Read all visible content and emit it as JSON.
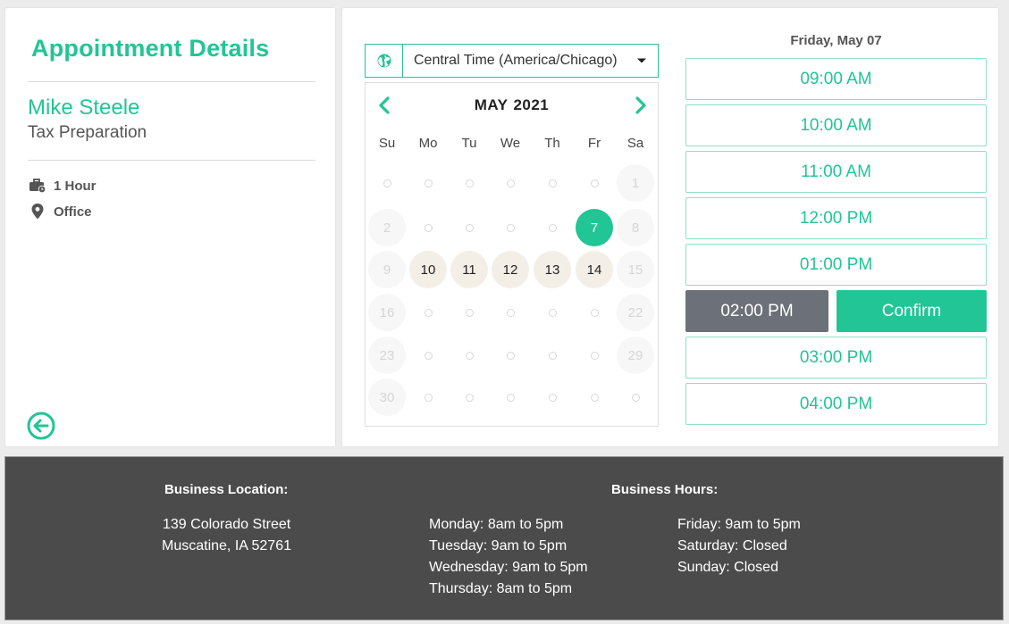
{
  "left": {
    "title": "Appointment Details",
    "name": "Mike Steele",
    "service": "Tax Preparation",
    "duration": "1 Hour",
    "location": "Office",
    "icons": {
      "duration": "briefcase-clock-icon",
      "location": "map-pin-icon",
      "back": "back-arrow-circle-icon"
    }
  },
  "timezone": {
    "label": "Central Time (America/Chicago)",
    "icon": "globe-icon"
  },
  "calendar": {
    "month": "MAY",
    "year": "2021",
    "weekdays": [
      "Su",
      "Mo",
      "Tu",
      "We",
      "Th",
      "Fr",
      "Sa"
    ],
    "selected_day": "7",
    "weeks": [
      [
        {
          "t": "",
          "s": "dot"
        },
        {
          "t": "",
          "s": "dot"
        },
        {
          "t": "",
          "s": "dot"
        },
        {
          "t": "",
          "s": "dot"
        },
        {
          "t": "",
          "s": "dot"
        },
        {
          "t": "",
          "s": "dot"
        },
        {
          "t": "1",
          "s": "off"
        }
      ],
      [
        {
          "t": "2",
          "s": "off"
        },
        {
          "t": "",
          "s": "dot"
        },
        {
          "t": "",
          "s": "dot"
        },
        {
          "t": "",
          "s": "dot"
        },
        {
          "t": "",
          "s": "dot"
        },
        {
          "t": "7",
          "s": "sel"
        },
        {
          "t": "8",
          "s": "off"
        }
      ],
      [
        {
          "t": "9",
          "s": "off"
        },
        {
          "t": "10",
          "s": "avail"
        },
        {
          "t": "11",
          "s": "avail"
        },
        {
          "t": "12",
          "s": "avail"
        },
        {
          "t": "13",
          "s": "avail"
        },
        {
          "t": "14",
          "s": "avail"
        },
        {
          "t": "15",
          "s": "off"
        }
      ],
      [
        {
          "t": "16",
          "s": "off"
        },
        {
          "t": "",
          "s": "dot"
        },
        {
          "t": "",
          "s": "dot"
        },
        {
          "t": "",
          "s": "dot"
        },
        {
          "t": "",
          "s": "dot"
        },
        {
          "t": "",
          "s": "dot"
        },
        {
          "t": "22",
          "s": "off"
        }
      ],
      [
        {
          "t": "23",
          "s": "off"
        },
        {
          "t": "",
          "s": "dot"
        },
        {
          "t": "",
          "s": "dot"
        },
        {
          "t": "",
          "s": "dot"
        },
        {
          "t": "",
          "s": "dot"
        },
        {
          "t": "",
          "s": "dot"
        },
        {
          "t": "29",
          "s": "off"
        }
      ],
      [
        {
          "t": "30",
          "s": "off"
        },
        {
          "t": "",
          "s": "dot"
        },
        {
          "t": "",
          "s": "dot"
        },
        {
          "t": "",
          "s": "dot"
        },
        {
          "t": "",
          "s": "dot"
        },
        {
          "t": "",
          "s": "dot"
        },
        {
          "t": "",
          "s": "dot"
        }
      ]
    ]
  },
  "schedule": {
    "date_heading": "Friday, May 07",
    "slots": [
      "09:00 AM",
      "10:00 AM",
      "11:00 AM",
      "12:00 PM",
      "01:00 PM",
      "02:00 PM",
      "03:00 PM",
      "04:00 PM"
    ],
    "selected_slot": "02:00 PM",
    "confirm_label": "Confirm"
  },
  "footer": {
    "location_heading": "Business Location:",
    "address_line1": "139 Colorado Street",
    "address_line2": "Muscatine, IA 52761",
    "hours_heading": "Business Hours:",
    "hours_col1": [
      "Monday: 8am to 5pm",
      "Tuesday: 9am to 5pm",
      "Wednesday: 9am to 5pm",
      "Thursday: 8am to 5pm"
    ],
    "hours_col2": [
      "Friday: 9am to 5pm",
      "Saturday: Closed",
      "Sunday: Closed"
    ]
  },
  "colors": {
    "accent": "#22c595",
    "selected_slot": "#6c7078",
    "available_day": "#f3efe6",
    "footer_bg": "#4b4b4b"
  }
}
